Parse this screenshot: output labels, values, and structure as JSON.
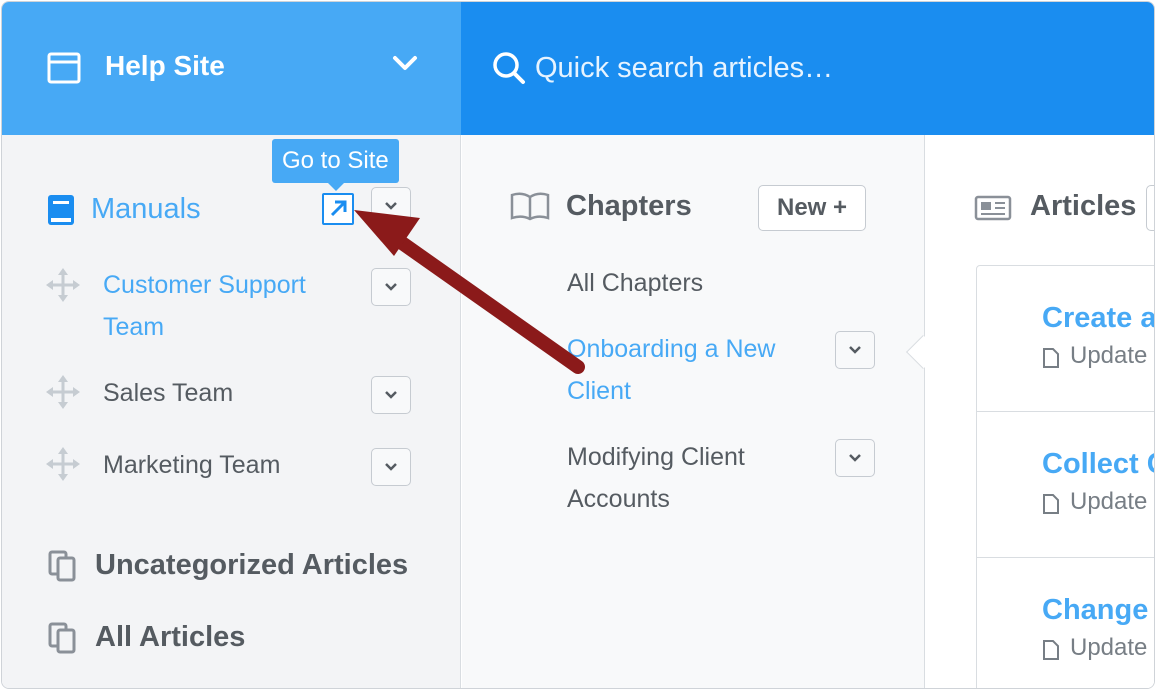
{
  "header": {
    "site_name": "Help Site",
    "search_placeholder": "Quick search articles…"
  },
  "sidebar": {
    "section_title": "Manuals",
    "tooltip": "Go to Site",
    "manuals": [
      {
        "label_line1": "Customer Support",
        "label_line2": "Team",
        "active": true
      },
      {
        "label_line1": "Sales Team",
        "active": false
      },
      {
        "label_line1": "Marketing Team",
        "active": false
      }
    ],
    "uncategorized_label": "Uncategorized Articles",
    "all_articles_label": "All Articles"
  },
  "chapters": {
    "title": "Chapters",
    "new_button_label": "New +",
    "items": [
      {
        "label_line1": "All Chapters"
      },
      {
        "label_line1": "Onboarding a New",
        "label_line2": "Client",
        "active": true
      },
      {
        "label_line1": "Modifying Client",
        "label_line2": "Accounts"
      }
    ]
  },
  "articles": {
    "title": "Articles",
    "items": [
      {
        "title": "Create a",
        "meta": "Update"
      },
      {
        "title": "Collect C",
        "meta": "Update"
      },
      {
        "title": "Change s",
        "meta": "Update"
      }
    ]
  },
  "colors": {
    "accent_light": "#47a9f5",
    "accent_dark": "#1a8df0",
    "annotation_arrow": "#8b1a1a"
  }
}
